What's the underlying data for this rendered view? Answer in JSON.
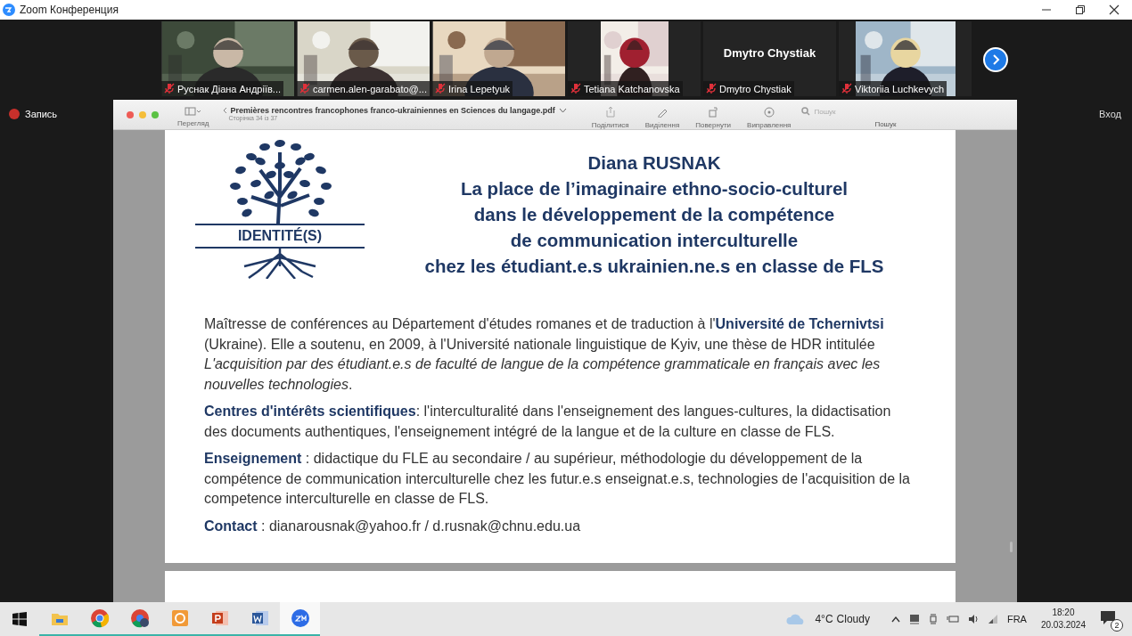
{
  "window": {
    "title": "Zoom Конференция"
  },
  "participants": [
    {
      "name": "Руснак Діана Андріїв...",
      "kind": "video",
      "muted": true
    },
    {
      "name": "carmen.alen-garabato@...",
      "kind": "video",
      "muted": true
    },
    {
      "name": "Irina Lepetyuk",
      "kind": "video",
      "muted": true
    },
    {
      "name": "Tetiana Katchanovska",
      "kind": "portrait",
      "muted": true
    },
    {
      "name": "Dmytro Chystiak",
      "kind": "name",
      "display_name": "Dmytro Chystiak",
      "muted": true
    },
    {
      "name": "Viktoriia Luchkevych",
      "kind": "portrait",
      "muted": true
    }
  ],
  "record_button": "Запись",
  "sign_in_button": "Вход",
  "viewer": {
    "sidebar_label": "Перегляд",
    "file_name": "Premières rencontres francophones franco-ukrainiennes en Sciences du langage.pdf",
    "page_info": "Сторінка 34 із 37",
    "tools": [
      {
        "kind": "share",
        "label": "Поділитися"
      },
      {
        "kind": "highlight",
        "label": "Виділення"
      },
      {
        "kind": "rotate",
        "label": "Повернути"
      },
      {
        "kind": "markup",
        "label": "Виправлення"
      }
    ],
    "search": {
      "placeholder": "Пошук",
      "label": "Пошук"
    }
  },
  "slide": {
    "logo_text": "IDENTITÉ(S)",
    "author": "Diana RUSNAK",
    "title_lines": [
      "La place de l’imaginaire ethno-socio-culturel",
      "dans le développement de la compétence",
      "de communication interculturelle",
      "chez les étudiant.e.s ukrainien.ne.s en classe de FLS"
    ],
    "paragraphs": [
      "Maîtresse de conférences au Département d'études romanes et de traduction à l'**Université de Tchernivtsi** (Ukraine). Elle a soutenu, en 2009, à l'Université nationale linguistique de Kyiv, une thèse de HDR intitulée *L'acquisition par des étudiant.e.s de faculté de langue de la compétence grammaticale en français avec les nouvelles technologies*.",
      "**Centres d'intérêts scientifiques**: l'interculturalité dans l'enseignement des langues-cultures, la didactisation des documents authentiques, l'enseignement intégré de la langue et de la culture en classe de FLS.",
      "**Enseignement** : didactique du FLE au secondaire / au supérieur, méthodologie du développement de la compétence de communication interculturelle chez les futur.e.s enseignat.e.s, technologies de l'acquisition de la competence interculturelle en classe de FLS.",
      "**Contact** : dianarousnak@yahoo.fr / d.rusnak@chnu.edu.ua"
    ]
  },
  "taskbar": {
    "apps": [
      {
        "kind": "explorer",
        "active": false
      },
      {
        "kind": "chrome",
        "active": false
      },
      {
        "kind": "chrome-profile",
        "active": false
      },
      {
        "kind": "slides",
        "active": false
      },
      {
        "kind": "powerpoint",
        "active": false
      },
      {
        "kind": "word",
        "active": false
      },
      {
        "kind": "zoom",
        "active": true
      }
    ],
    "weather": {
      "temperature": "4°C",
      "condition": "Cloudy"
    },
    "language": "FRA",
    "time": "18:20",
    "date": "20.03.2024",
    "notifications": "2"
  }
}
